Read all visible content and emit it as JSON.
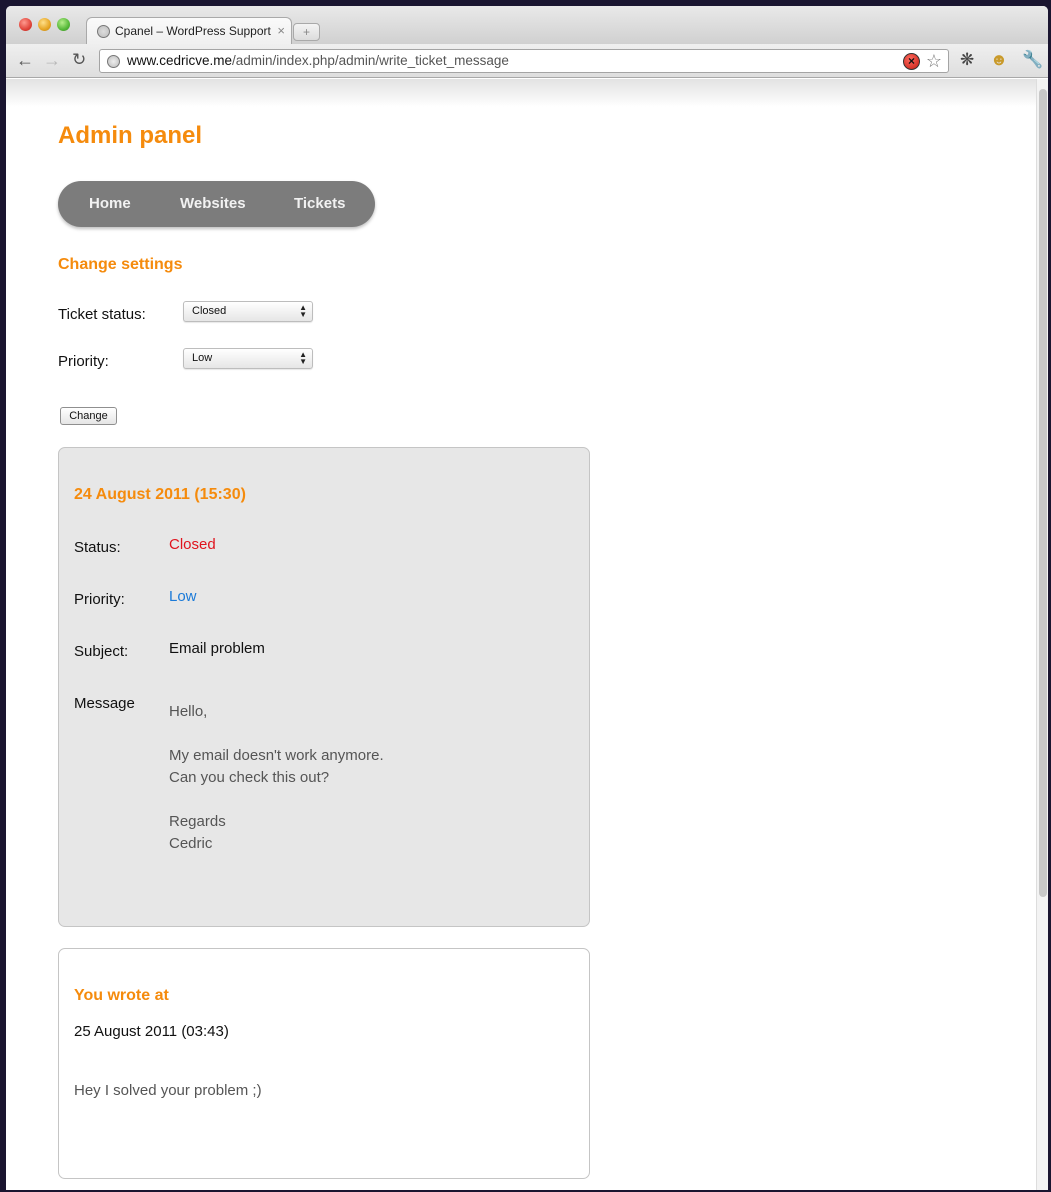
{
  "browser": {
    "tab_title": "Cpanel – WordPress Support",
    "url_host": "www.cedricve.me",
    "url_path": "/admin/index.php/admin/write_ticket_message",
    "new_tab_symbol": "+",
    "tab_close_symbol": "×",
    "icons": [
      "back-icon",
      "forward-icon",
      "reload-icon",
      "globe-icon",
      "stop-icon",
      "star-icon",
      "extension-icon",
      "wrench-icon"
    ]
  },
  "page": {
    "title": "Admin panel",
    "nav": [
      "Home",
      "Websites",
      "Tickets"
    ],
    "section_title": "Change settings",
    "form": {
      "status_label": "Ticket status:",
      "status_value": "Closed",
      "priority_label": "Priority:",
      "priority_value": "Low",
      "submit_label": "Change"
    },
    "ticket": {
      "date": "24 August 2011 (15:30)",
      "status_label": "Status:",
      "status_value": "Closed",
      "priority_label": "Priority:",
      "priority_value": "Low",
      "subject_label": "Subject:",
      "subject_value": "Email problem",
      "message_label": "Message",
      "message_lines": [
        "Hello,",
        "My email doesn't work anymore.",
        "Can you check this out?",
        "Regards",
        "Cedric"
      ]
    },
    "reply": {
      "title": "You wrote at",
      "date": "25 August 2011 (03:43)",
      "message": "Hey I solved your problem ;)"
    }
  },
  "colors": {
    "accent_orange": "#f58b0d",
    "status_closed": "#e0141e",
    "priority_low": "#1b7ad8",
    "nav_bg": "#7c7c7c"
  }
}
